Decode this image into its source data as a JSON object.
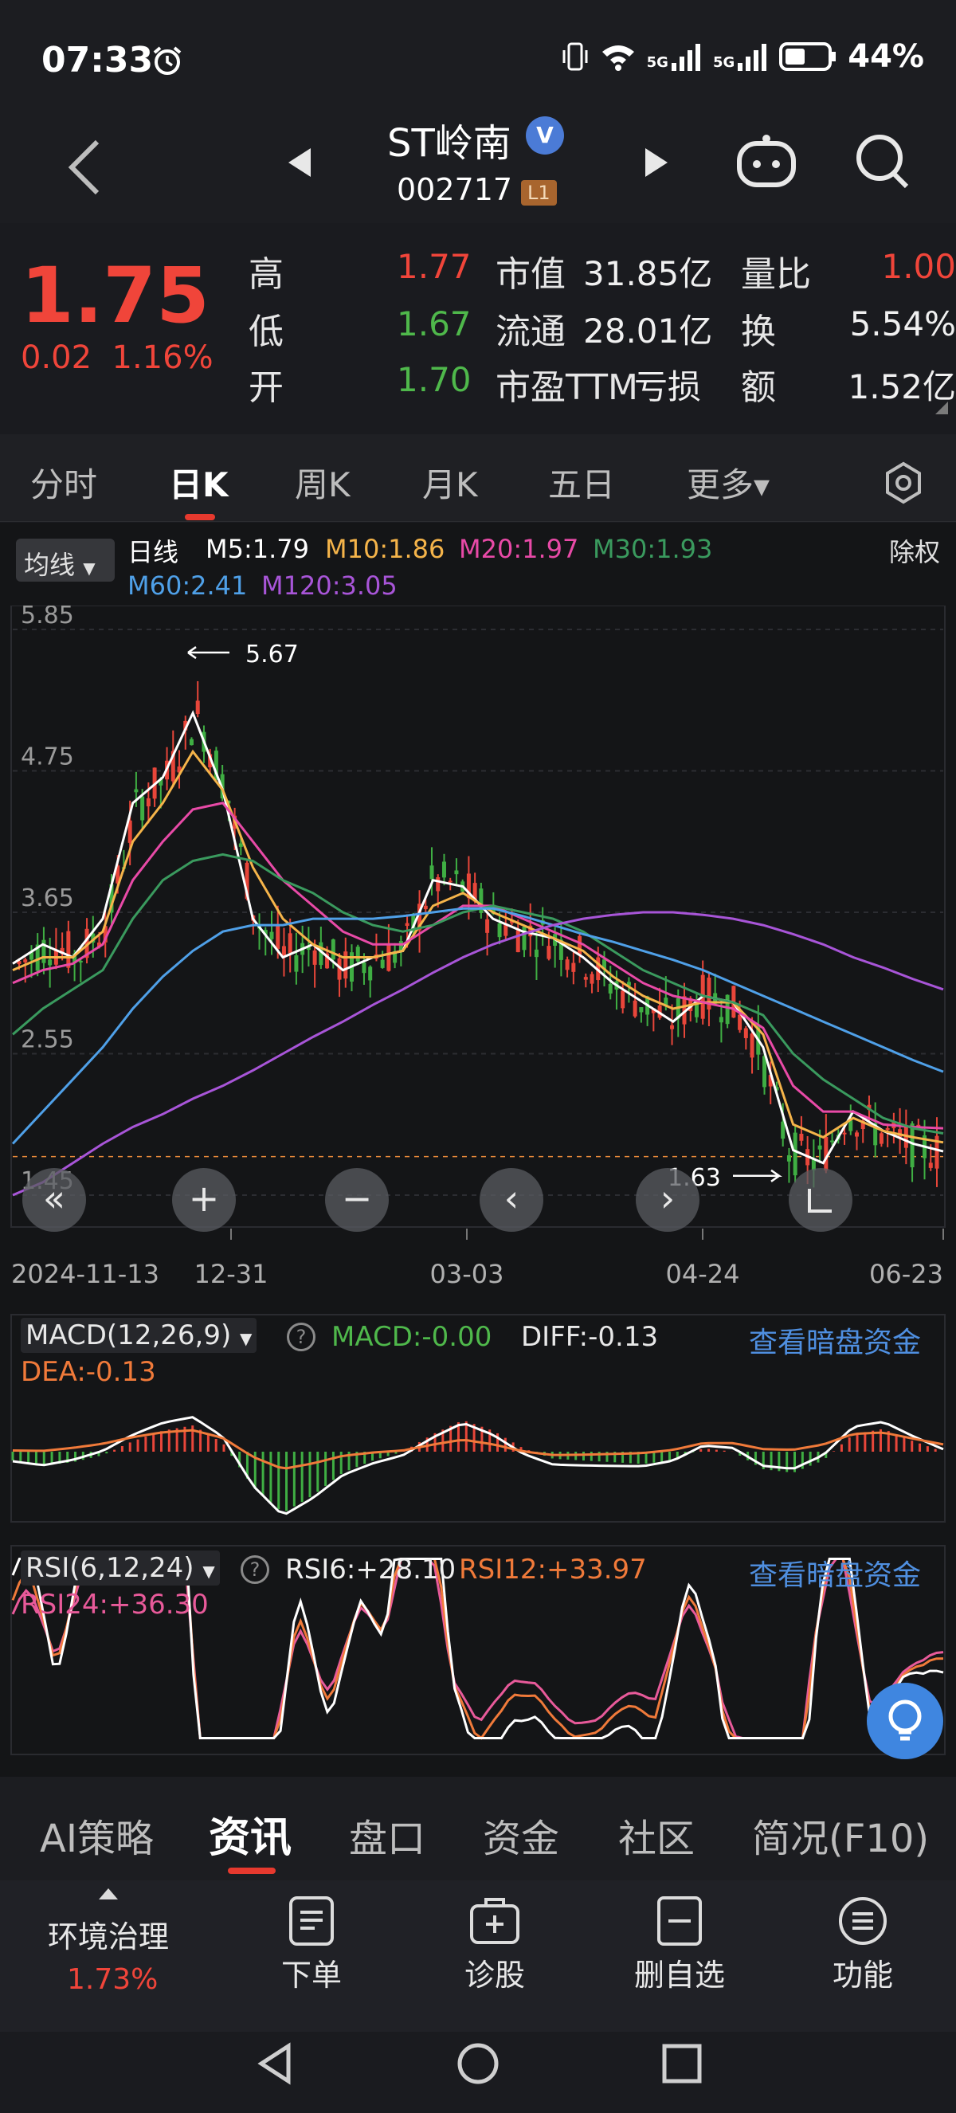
{
  "status_bar": {
    "time": "07:33",
    "battery": "44%",
    "net1": "5G",
    "net2": "5G"
  },
  "header": {
    "stock_name": "ST岭南",
    "verified_badge": "V",
    "stock_code": "002717",
    "level_badge": "L1"
  },
  "quote": {
    "price": "1.75",
    "change": "0.02",
    "change_pct": "1.16%",
    "rows": [
      {
        "l1": "高",
        "v1": "1.77",
        "l2": "市值",
        "v2": "31.85亿",
        "l3": "量比",
        "v3": "1.00"
      },
      {
        "l1": "低",
        "v1": "1.67",
        "l2": "流通",
        "v2": "28.01亿",
        "l3": "换",
        "v3": "5.54%"
      },
      {
        "l1": "开",
        "v1": "1.70",
        "l2": "市盈TTM",
        "v2": "亏损",
        "l3": "额",
        "v3": "1.52亿"
      }
    ]
  },
  "period_tabs": [
    "分时",
    "日K",
    "周K",
    "月K",
    "五日",
    "更多"
  ],
  "chart_header": {
    "avg_button": "均线",
    "daily_label": "日线",
    "ma5": "M5:1.79",
    "ma10": "M10:1.86",
    "ma20": "M20:1.97",
    "ma30": "M30:1.93",
    "ma60": "M60:2.41",
    "ma120": "M120:3.05",
    "adjust": "除权"
  },
  "chart_data": {
    "type": "line",
    "title": "",
    "price_ticks": [
      "5.85",
      "4.75",
      "3.65",
      "2.55",
      "1.45"
    ],
    "date_ticks": [
      "2024-11-13",
      "12-31",
      "03-03",
      "04-24",
      "06-23"
    ],
    "high_annotation": "5.67",
    "low_annotation": "1.63",
    "ylim": [
      1.45,
      5.85
    ],
    "series": [
      {
        "name": "M5",
        "color": "#ffffff",
        "values": [
          3.25,
          3.4,
          3.3,
          3.6,
          4.5,
          4.7,
          5.2,
          4.6,
          3.6,
          3.3,
          3.4,
          3.2,
          3.3,
          3.35,
          3.9,
          3.85,
          3.6,
          3.5,
          3.45,
          3.3,
          3.1,
          2.95,
          2.8,
          3.0,
          2.95,
          2.6,
          1.8,
          1.7,
          2.1,
          1.95,
          1.85,
          1.79
        ]
      },
      {
        "name": "M10",
        "color": "#f5b44a",
        "values": [
          3.2,
          3.3,
          3.3,
          3.5,
          4.2,
          4.5,
          4.9,
          4.6,
          4.0,
          3.6,
          3.4,
          3.3,
          3.3,
          3.35,
          3.7,
          3.8,
          3.65,
          3.55,
          3.45,
          3.35,
          3.15,
          3.0,
          2.9,
          2.95,
          2.95,
          2.7,
          2.0,
          1.9,
          2.05,
          1.95,
          1.9,
          1.86
        ]
      },
      {
        "name": "M20",
        "color": "#e84aa7",
        "values": [
          3.1,
          3.2,
          3.25,
          3.4,
          3.9,
          4.2,
          4.45,
          4.5,
          4.2,
          3.9,
          3.7,
          3.5,
          3.4,
          3.4,
          3.55,
          3.7,
          3.7,
          3.6,
          3.5,
          3.4,
          3.25,
          3.1,
          3.0,
          2.95,
          2.9,
          2.75,
          2.3,
          2.1,
          2.1,
          2.0,
          1.98,
          1.97
        ]
      },
      {
        "name": "M30",
        "color": "#3a9a5e",
        "values": [
          2.7,
          2.9,
          3.05,
          3.2,
          3.6,
          3.9,
          4.05,
          4.1,
          4.05,
          3.9,
          3.8,
          3.65,
          3.55,
          3.5,
          3.55,
          3.65,
          3.7,
          3.65,
          3.6,
          3.5,
          3.35,
          3.2,
          3.1,
          3.0,
          2.95,
          2.85,
          2.55,
          2.35,
          2.2,
          2.05,
          1.97,
          1.93
        ]
      },
      {
        "name": "M60",
        "color": "#4fa0e8",
        "values": [
          1.85,
          2.1,
          2.35,
          2.6,
          2.9,
          3.15,
          3.35,
          3.5,
          3.55,
          3.55,
          3.6,
          3.6,
          3.6,
          3.62,
          3.65,
          3.68,
          3.68,
          3.62,
          3.55,
          3.48,
          3.42,
          3.35,
          3.28,
          3.2,
          3.1,
          3.0,
          2.9,
          2.8,
          2.7,
          2.6,
          2.5,
          2.41
        ]
      },
      {
        "name": "M120",
        "color": "#a855d8",
        "values": [
          1.45,
          1.55,
          1.7,
          1.85,
          1.98,
          2.08,
          2.2,
          2.3,
          2.42,
          2.55,
          2.68,
          2.8,
          2.93,
          3.05,
          3.18,
          3.3,
          3.4,
          3.48,
          3.55,
          3.6,
          3.63,
          3.65,
          3.65,
          3.63,
          3.6,
          3.55,
          3.48,
          3.4,
          3.3,
          3.22,
          3.13,
          3.05
        ]
      }
    ]
  },
  "chart_nav": {
    "b1": "«",
    "b2": "+",
    "b3": "−",
    "b4": "‹",
    "b5": "›"
  },
  "macd": {
    "label": "MACD(12,26,9)",
    "help": "?",
    "macd": "MACD:-0.00",
    "diff": "DIFF:-0.13",
    "dea": "DEA:-0.13",
    "link": "查看暗盘资金",
    "hist": [
      -0.05,
      -0.08,
      -0.06,
      -0.02,
      0.06,
      0.12,
      0.15,
      0.05,
      -0.2,
      -0.35,
      -0.25,
      -0.12,
      -0.05,
      0.0,
      0.1,
      0.18,
      0.12,
      0.02,
      -0.04,
      -0.05,
      -0.06,
      -0.07,
      -0.05,
      0.02,
      0.0,
      -0.1,
      -0.12,
      -0.05,
      0.1,
      0.13,
      0.06,
      0.0
    ]
  },
  "rsi": {
    "label": "RSI(6,12,24)",
    "help": "?",
    "rsi6": "RSI6:+28.10",
    "rsi12": "RSI12:+33.97",
    "rsi24": "RSI24:+36.30",
    "link": "查看暗盘资金"
  },
  "bottom_tabs": [
    "AI策略",
    "资讯",
    "盘口",
    "资金",
    "社区",
    "简况(F10)"
  ],
  "toolbar": {
    "sector": "环境治理",
    "sector_pct": "1.73%",
    "items": [
      "下单",
      "诊股",
      "删自选",
      "功能"
    ]
  }
}
